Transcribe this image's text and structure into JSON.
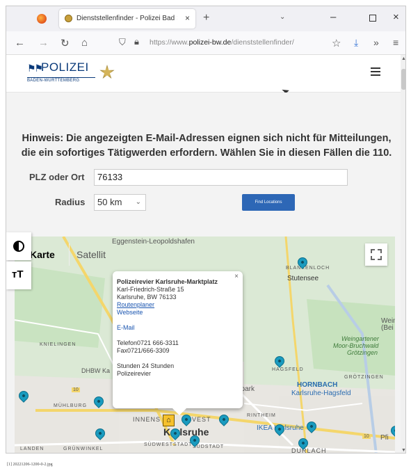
{
  "browser": {
    "tab_title": "Dienststellenfinder - Polizei Bad ×",
    "tab_close": "×",
    "new_tab": "+",
    "tab_list": "⌄",
    "url_scheme": "https://www.",
    "url_domain": "polizei-bw.de",
    "url_path": "/dienststellenfinder/",
    "window_minimize": "–",
    "window_close": "×"
  },
  "site": {
    "logo_word": "POLIZEI",
    "logo_sub": "BADEN-WÜRTTEMBERG"
  },
  "page": {
    "hint": "Hinweis: Die angezeigten E-Mail-Adressen eignen sich nicht für Mitteilungen, die ein sofortiges Tätigwerden erfordern. Wählen Sie in diesen Fällen die 110.",
    "plz_label": "PLZ oder Ort",
    "plz_value": "76133",
    "radius_label": "Radius",
    "radius_value": "50 km",
    "find_button": "Find Locations"
  },
  "map": {
    "type_map": "Karte",
    "type_satellite": "Satellit",
    "labels": {
      "eggenstein": "Eggenstein-Leopoldshafen",
      "blankenloch": "BLANKENLOCH",
      "stutensee": "Stutensee",
      "weing": "Weing",
      "bei": "(Bei",
      "knielingen": "KNIELINGEN",
      "dhbw": "DHBW Ka",
      "weingartener": "Weingartener",
      "moorbruchwald": "Moor-Bruchwald",
      "grotzingen": "Grötzingen",
      "hagsfeld_caps": "HAGSFELD",
      "grotzingen_caps": "GRÖTZINGEN",
      "muhlburg": "MÜHLBURG",
      "dpark": "dpark",
      "hornbach": "HORNBACH",
      "hornbach_sub": "Karlsruhe-Hagsfeld",
      "rintheim": "RINTHEIM",
      "innenst": "INNENS",
      "west": "VEST",
      "karlsruhe": "Karlsruhe",
      "ikea": "IKEA Karlsruhe",
      "pfi": "Pfi",
      "landen": "LANDEN",
      "grunwinkel": "GRÜNWINKEL",
      "sudweststadt": "SÜDWESTSTADT",
      "sudstadt": "SÜDSTADT",
      "durlach": "DURLACH",
      "road_10": "10",
      "road_10b": "10"
    }
  },
  "infowindow": {
    "title": "Polizeirevier Karlsruhe-Marktplatz",
    "street": "Karl-Friedrich-Straße 15",
    "city": "Karlsruhe, BW 76133",
    "route": "Routenplaner",
    "website": "Webseite",
    "email": "E-Mail",
    "phone": "Telefon0721 666-3311",
    "fax": "Fax0721/666-3309",
    "hours": "Stunden 24 Stunden",
    "type": "Polizeirevier",
    "close": "×"
  },
  "caption": "[1] 20221206-1200-0-2.jpg"
}
